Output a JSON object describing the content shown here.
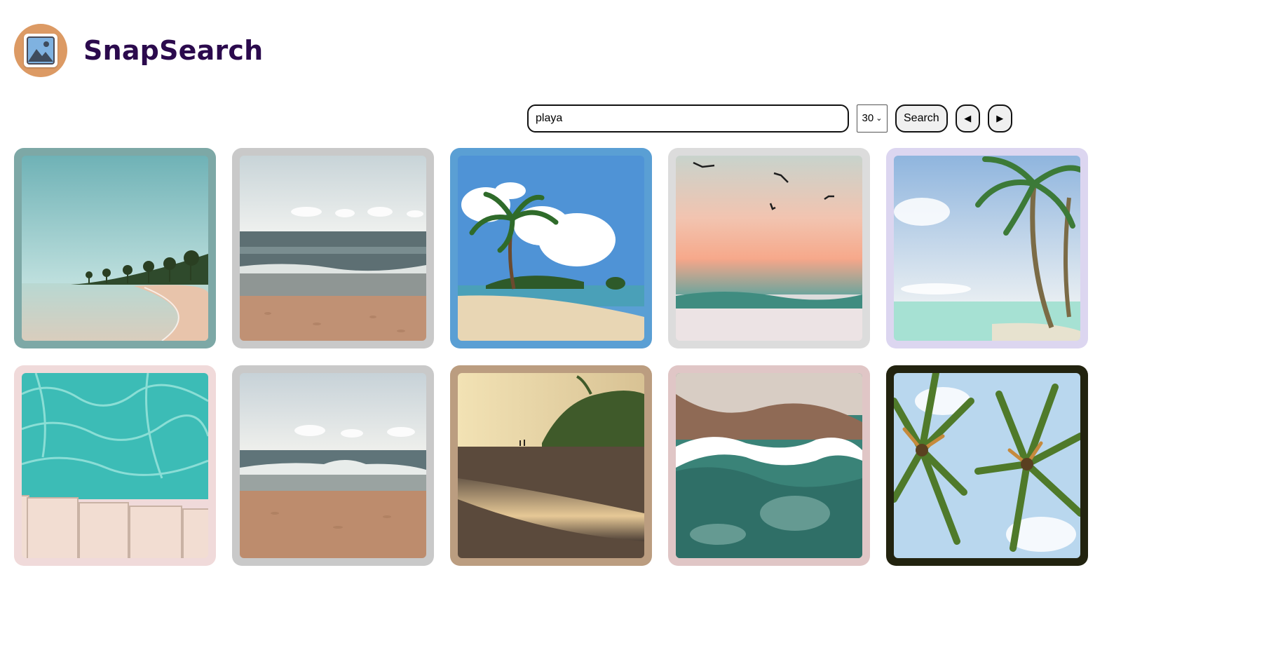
{
  "app": {
    "name": "SnapSearch",
    "logo_icon": "image-icon",
    "brand_color": "#2b0a4d",
    "logo_bg": "#dc9a64"
  },
  "search": {
    "value": "playa",
    "placeholder": "",
    "count_selected": "30",
    "button_label": "Search",
    "prev_icon": "triangle-left-icon",
    "next_icon": "triangle-right-icon",
    "prev_glyph": "◀",
    "next_glyph": "▶"
  },
  "results": [
    {
      "subject": "beach-palms-turquoise",
      "frame_color": "#7da8a6"
    },
    {
      "subject": "sand-waves-grey-sky",
      "frame_color": "#c9c9c9"
    },
    {
      "subject": "palm-island-blue-sky",
      "frame_color": "#5a9fd4"
    },
    {
      "subject": "birds-pink-sunset-sea",
      "frame_color": "#dcdcdc"
    },
    {
      "subject": "tall-palms-lagoon",
      "frame_color": "#dcd6f0"
    },
    {
      "subject": "pool-water-wooden-deck",
      "frame_color": "#f0dada"
    },
    {
      "subject": "beach-wave-breaking",
      "frame_color": "#c9c9c9"
    },
    {
      "subject": "golden-hour-shoreline",
      "frame_color": "#bb9d80"
    },
    {
      "subject": "aerial-surf-sand",
      "frame_color": "#e0c6c6"
    },
    {
      "subject": "palm-canopy-from-below",
      "frame_color": "#22230f"
    }
  ]
}
